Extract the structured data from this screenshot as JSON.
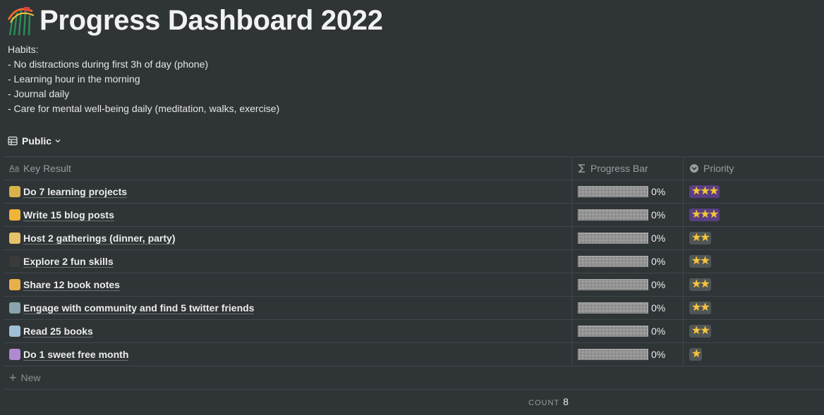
{
  "page": {
    "title": "Progress Dashboard 2022",
    "description": [
      "Habits:",
      "- No distractions during first 3h of day (phone)",
      "- Learning hour in the morning",
      "- Journal daily",
      "- Care for mental well-being daily (meditation, walks, exercise)"
    ]
  },
  "view": {
    "label": "Public"
  },
  "table": {
    "headers": {
      "key_result": "Key Result",
      "progress": "Progress Bar",
      "priority": "Priority"
    },
    "rows": [
      {
        "key_result": "Do 7 learning projects",
        "progress": 0,
        "progress_label": "0%",
        "priority": 3
      },
      {
        "key_result": "Write 15 blog posts",
        "progress": 0,
        "progress_label": "0%",
        "priority": 3
      },
      {
        "key_result": "Host 2 gatherings (dinner, party)",
        "progress": 0,
        "progress_label": "0%",
        "priority": 2
      },
      {
        "key_result": "Explore 2 fun skills",
        "progress": 0,
        "progress_label": "0%",
        "priority": 2
      },
      {
        "key_result": "Share 12 book notes",
        "progress": 0,
        "progress_label": "0%",
        "priority": 2
      },
      {
        "key_result": "Engage with community and find 5 twitter friends",
        "progress": 0,
        "progress_label": "0%",
        "priority": 2
      },
      {
        "key_result": "Read 25 books",
        "progress": 0,
        "progress_label": "0%",
        "priority": 2
      },
      {
        "key_result": "Do 1 sweet free month",
        "progress": 0,
        "progress_label": "0%",
        "priority": 1
      }
    ],
    "new_label": "New"
  },
  "footer": {
    "count_label": "COUNT",
    "count_value": "8"
  },
  "colors": {
    "background": "#2f3437",
    "star": "#f4c542",
    "priority_high": "#5a3f83"
  }
}
